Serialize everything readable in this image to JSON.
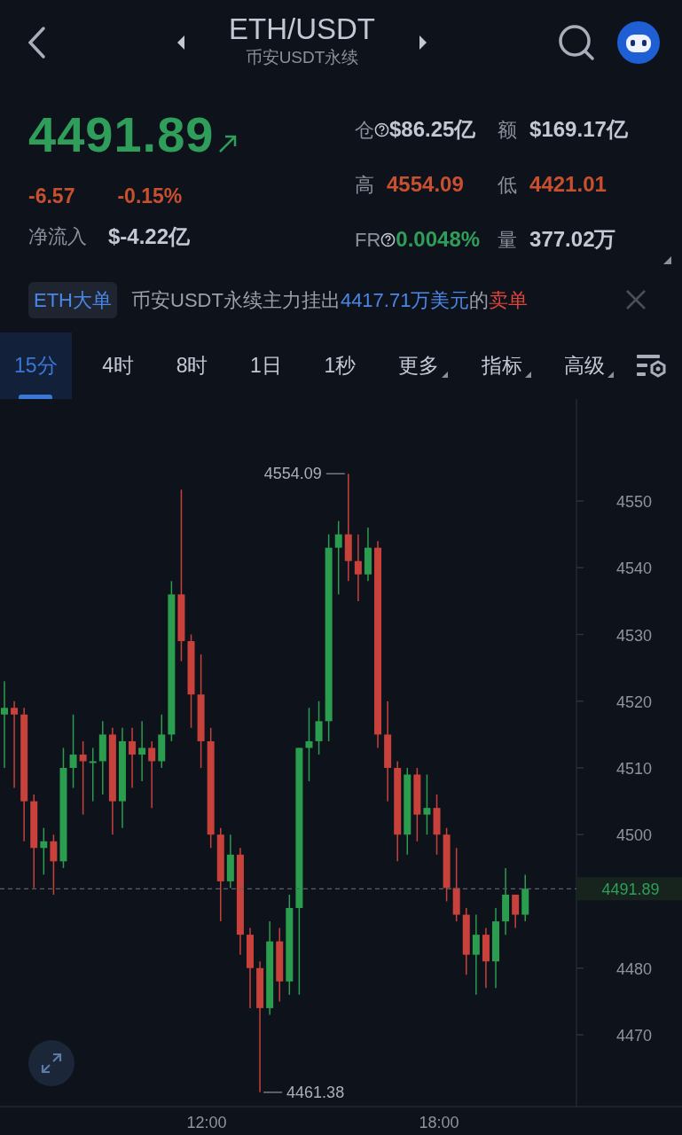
{
  "header": {
    "title": "ETH/USDT",
    "subtitle": "币安USDT永续"
  },
  "ticker": {
    "price": {
      "text": "4491.89",
      "color": "#2e9e5a"
    },
    "rising": true,
    "change": {
      "text": "-6.57",
      "color": "#c8502e"
    },
    "change_pct": {
      "text": "-0.15%",
      "color": "#c8502e"
    },
    "netflow_label": "净流入",
    "netflow_value": "$-4.22亿"
  },
  "stats": [
    {
      "label": "仓",
      "help": true,
      "value": "$86.25亿",
      "color": "#c3c9d4"
    },
    {
      "label": "额",
      "help": false,
      "value": "$169.17亿",
      "color": "#c3c9d4"
    },
    {
      "label": "高",
      "help": false,
      "value": "4554.09",
      "color": "#c8502e"
    },
    {
      "label": "低",
      "help": false,
      "value": "4421.01",
      "color": "#c8502e"
    },
    {
      "label": "FR",
      "help": true,
      "value": "0.0048%",
      "color": "#2e9e5a"
    },
    {
      "label": "量",
      "help": false,
      "value": "377.02万",
      "color": "#c3c9d4"
    }
  ],
  "banner": {
    "tag": "ETH大单",
    "segments": [
      {
        "text": "币安USDT永续主力挂出",
        "kind": "plain"
      },
      {
        "text": "4417.71万美元",
        "kind": "amount"
      },
      {
        "text": "的",
        "kind": "plain"
      },
      {
        "text": "卖单",
        "kind": "sell"
      }
    ]
  },
  "tabs": [
    {
      "label": "15分",
      "kind": "interval",
      "selected": true
    },
    {
      "label": "4时",
      "kind": "interval",
      "selected": false
    },
    {
      "label": "8时",
      "kind": "interval",
      "selected": false
    },
    {
      "label": "1日",
      "kind": "interval",
      "selected": false
    },
    {
      "label": "1秒",
      "kind": "interval",
      "selected": false
    },
    {
      "label": "更多",
      "kind": "dropdown",
      "selected": false
    },
    {
      "label": "指标",
      "kind": "dropdown",
      "selected": false
    },
    {
      "label": "高级",
      "kind": "dropdown",
      "selected": false
    }
  ],
  "chart": {
    "y_axis_labels": [
      "4550",
      "4540",
      "4530",
      "4520",
      "4510",
      "4500",
      "4480",
      "4470"
    ],
    "x_axis_labels": [
      "12:00",
      "18:00"
    ],
    "high_label": "4554.09",
    "low_label": "4461.38",
    "last_price_label": "4491.89"
  }
}
